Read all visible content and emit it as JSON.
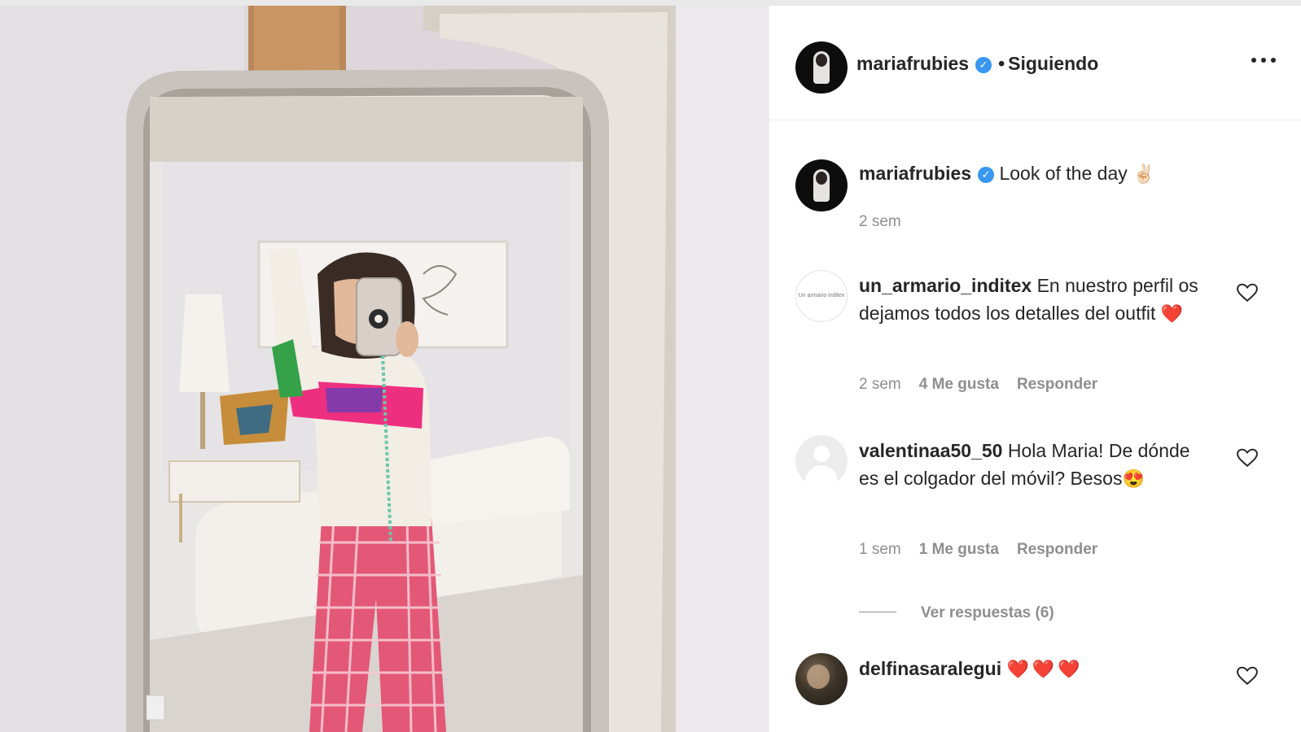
{
  "post": {
    "image_alt": "",
    "owner": {
      "username": "mariafrubies",
      "verified_icon": "verified-badge-icon",
      "separator": "•",
      "follow_status": "Siguiendo"
    },
    "more_icon": "more-options-icon"
  },
  "caption": {
    "username": "mariafrubies",
    "text": "Look of the day",
    "emoji": "✌🏻",
    "time": "2 sem"
  },
  "comments": [
    {
      "username": "un_armario_inditex",
      "text": "En nuestro perfil os dejamos todos los detalles del outfit",
      "emoji": "❤️",
      "time": "2 sem",
      "likes": "4 Me gusta",
      "reply": "Responder",
      "avatar_text": "Un armario inditex"
    },
    {
      "username": "valentinaa50_50",
      "text": "Hola Maria! De dónde es el colgador del móvil? Besos",
      "emoji": "😍",
      "time": "1 sem",
      "likes": "1 Me gusta",
      "reply": "Responder",
      "view_replies": "Ver respuestas (6)"
    },
    {
      "username": "delfinasaralegui",
      "text": "",
      "emoji": "❤️❤️❤️"
    }
  ],
  "colors": {
    "verified": "#3897f0",
    "text": "#262626",
    "secondary": "#8e8e8e",
    "heart_emoji": "#e0245e"
  }
}
